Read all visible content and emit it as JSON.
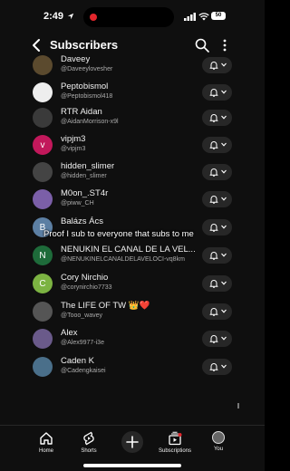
{
  "status_bar": {
    "time": "2:49",
    "battery": "50"
  },
  "header": {
    "title": "Subscribers"
  },
  "overlay": {
    "text": "Proof I sub to everyone that subs to me"
  },
  "subscribers": [
    {
      "name": "Daveey",
      "handle": "@Daveeylovesher",
      "avatar_color": "#5b4a2e",
      "avatar_letter": ""
    },
    {
      "name": "Peptobismol",
      "handle": "@Peptobismol418",
      "avatar_color": "#eeeeee",
      "avatar_letter": ""
    },
    {
      "name": "RTR Aidan",
      "handle": "@AidanMorrison-x9l",
      "avatar_color": "#3a3a3a",
      "avatar_letter": ""
    },
    {
      "name": "vipjm3",
      "handle": "@vipjm3",
      "avatar_color": "#c2185b",
      "avatar_letter": "v"
    },
    {
      "name": "hidden_slimer",
      "handle": "@hidden_slimer",
      "avatar_color": "#444444",
      "avatar_letter": ""
    },
    {
      "name": "M0on_.ST4r",
      "handle": "@piww_CH",
      "avatar_color": "#7b5fa8",
      "avatar_letter": ""
    },
    {
      "name": "Balázs Ács",
      "handle": "",
      "avatar_color": "#5c7fa3",
      "avatar_letter": "B"
    },
    {
      "name": "NENUKIN EL CANAL DE LA VEL...",
      "handle": "@NENUKINELCANALDELAVELOCI-vq8km",
      "avatar_color": "#1e6b3a",
      "avatar_letter": "N"
    },
    {
      "name": "Cory Nirchio",
      "handle": "@corynirchio7733",
      "avatar_color": "#7cb342",
      "avatar_letter": "C"
    },
    {
      "name": "The LIFE OF TW 👑❤️",
      "handle": "@Tooo_wavey",
      "avatar_color": "#555555",
      "avatar_letter": ""
    },
    {
      "name": "Alex",
      "handle": "@Alex9977-i3e",
      "avatar_color": "#6a5a8a",
      "avatar_letter": ""
    },
    {
      "name": "Caden K",
      "handle": "@Cadengkaisei",
      "avatar_color": "#4a6f8a",
      "avatar_letter": ""
    }
  ],
  "nav": {
    "home": "Home",
    "shorts": "Shorts",
    "subscriptions": "Subscriptions",
    "you": "You"
  },
  "icons": {
    "back": "chevron-left-icon",
    "search": "search-icon",
    "more": "more-vertical-icon",
    "bell": "bell-icon",
    "chevron": "chevron-down-icon"
  }
}
